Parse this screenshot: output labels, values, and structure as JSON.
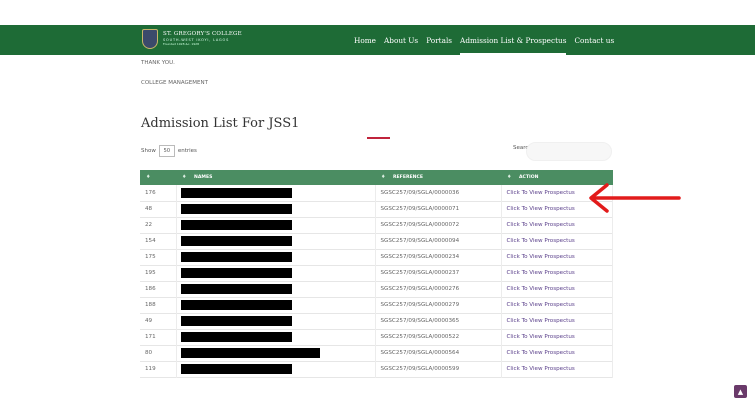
{
  "header": {
    "logo_name": "ST. GREGORY'S COLLEGE",
    "logo_sub": "SOUTH-WEST IKOYI, LAGOS",
    "logo_est": "Founded 1928 &c. 1928",
    "nav": [
      {
        "label": "Home",
        "active": false
      },
      {
        "label": "About Us",
        "active": false
      },
      {
        "label": "Portals",
        "active": false
      },
      {
        "label": "Admission List & Prospectus",
        "active": true
      },
      {
        "label": "Contact us",
        "active": false
      }
    ]
  },
  "content": {
    "thank_you": "THANK YOU.",
    "management": "COLLEGE MANAGEMENT",
    "heading": "Admission List For JSS1",
    "show_label": "Show",
    "show_value": "50",
    "entries_label": "entries",
    "search_label": "Search:",
    "search_value": ""
  },
  "table": {
    "headers": [
      "",
      "NAMES",
      "REFERENCE",
      "ACTION"
    ],
    "rows": [
      {
        "sn": "176",
        "ref": "SGSC257/09/SGLA/0000036",
        "action": "Click To View Prospectus",
        "redact_w": 111
      },
      {
        "sn": "48",
        "ref": "SGSC257/09/SGLA/0000071",
        "action": "Click To View Prospectus",
        "redact_w": 111
      },
      {
        "sn": "22",
        "ref": "SGSC257/09/SGLA/0000072",
        "action": "Click To View Prospectus",
        "redact_w": 111
      },
      {
        "sn": "154",
        "ref": "SGSC257/09/SGLA/0000094",
        "action": "Click To View Prospectus",
        "redact_w": 111
      },
      {
        "sn": "175",
        "ref": "SGSC257/09/SGLA/0000234",
        "action": "Click To View Prospectus",
        "redact_w": 111
      },
      {
        "sn": "195",
        "ref": "SGSC257/09/SGLA/0000237",
        "action": "Click To View Prospectus",
        "redact_w": 111
      },
      {
        "sn": "186",
        "ref": "SGSC257/09/SGLA/0000276",
        "action": "Click To View Prospectus",
        "redact_w": 111
      },
      {
        "sn": "188",
        "ref": "SGSC257/09/SGLA/0000279",
        "action": "Click To View Prospectus",
        "redact_w": 111
      },
      {
        "sn": "49",
        "ref": "SGSC257/09/SGLA/0000365",
        "action": "Click To View Prospectus",
        "redact_w": 111
      },
      {
        "sn": "171",
        "ref": "SGSC257/09/SGLA/0000522",
        "action": "Click To View Prospectus",
        "redact_w": 111
      },
      {
        "sn": "80",
        "ref": "SGSC257/09/SGLA/0000564",
        "action": "Click To View Prospectus",
        "redact_w": 139
      },
      {
        "sn": "119",
        "ref": "SGSC257/09/SGLA/0000599",
        "action": "Click To View Prospectus",
        "redact_w": 111
      }
    ]
  },
  "colors": {
    "nav_bg": "#1e6b36",
    "table_header": "#4b8d62",
    "action_link": "#5a3f8a",
    "arrow": "#e21b1b"
  },
  "icons": {
    "scroll_top": "chevron-up-icon",
    "annotation": "arrow-left-icon"
  }
}
